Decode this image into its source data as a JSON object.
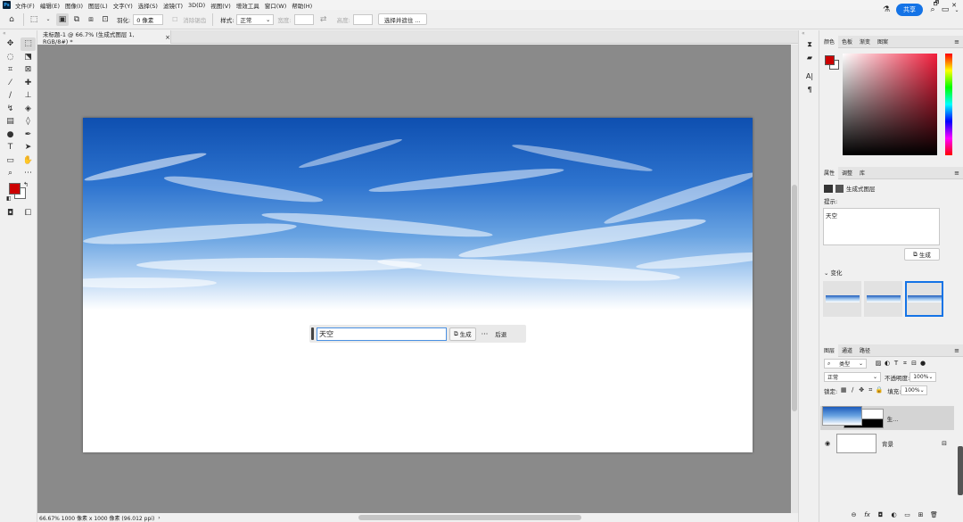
{
  "menubar": {
    "logo": "Ps",
    "items": [
      "文件(F)",
      "编辑(E)",
      "图像(I)",
      "图层(L)",
      "文字(Y)",
      "选择(S)",
      "滤镜(T)",
      "3D(D)",
      "视图(V)",
      "增效工具",
      "窗口(W)",
      "帮助(H)"
    ],
    "win_minimize": "—",
    "win_restore": "🗗",
    "win_close": "✕"
  },
  "options": {
    "feather_label": "羽化:",
    "feather_value": "0 像素",
    "antialias_label": "消除锯齿",
    "style_label": "样式:",
    "style_value": "正常",
    "width_label": "宽度:",
    "height_label": "高度:",
    "select_mask_button": "选择并遮住 ...",
    "share_button": "共享"
  },
  "document": {
    "tab_title": "未标题-1 @ 66.7% (生成式图层 1, RGB/8#) *",
    "tab_close": "×",
    "status_text": "66.67%   1000 像素 x 1000 像素 (96.012 ppi)"
  },
  "genbar": {
    "prompt_value": "天空",
    "generate_label": "生成",
    "more_label": "···",
    "back_label": "后退"
  },
  "color_panel": {
    "tabs": [
      "颜色",
      "色板",
      "渐变",
      "图案"
    ],
    "foreground_color": "#cc0000",
    "background_color": "#ffffff"
  },
  "properties_panel": {
    "tabs": [
      "属性",
      "调整",
      "库"
    ],
    "layer_type": "生成式图层",
    "prompt_label": "提示:",
    "prompt_text": "天空",
    "generate_button": "生成",
    "variations_label": "变化"
  },
  "layers_panel": {
    "tabs": [
      "图层",
      "通道",
      "路径"
    ],
    "kind_filter": "类型",
    "blend_mode": "正常",
    "opacity_label": "不透明度:",
    "opacity_value": "100%",
    "lock_label": "锁定:",
    "fill_label": "填充:",
    "fill_value": "100%",
    "layers": [
      {
        "name": "生...",
        "selected": true
      },
      {
        "name": "背景",
        "selected": false
      }
    ]
  }
}
